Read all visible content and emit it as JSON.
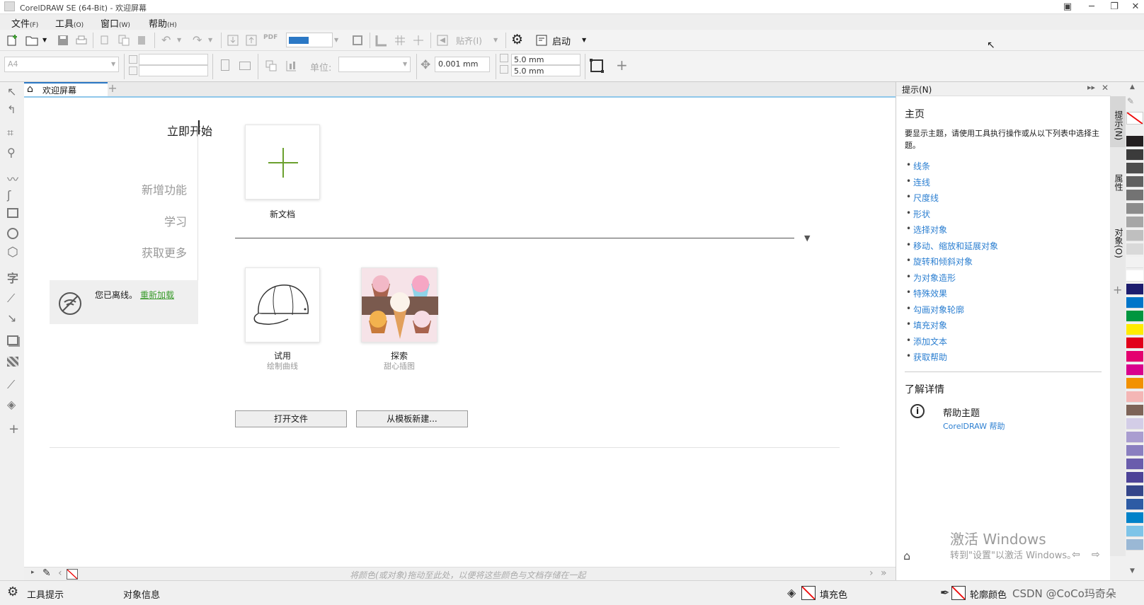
{
  "window": {
    "title": "CorelDRAW SE (64-Bit) - 欢迎屏幕"
  },
  "menu": [
    {
      "label": "文件",
      "key": "(F)"
    },
    {
      "label": "工具",
      "key": "(O)"
    },
    {
      "label": "窗口",
      "key": "(W)"
    },
    {
      "label": "帮助",
      "key": "(H)"
    }
  ],
  "toolbar": {
    "snap_label": "贴齐(I)",
    "launch_label": "启动",
    "pdf_label": "PDF"
  },
  "propbar": {
    "page_size": "A4",
    "unit_label": "单位:",
    "nudge": "0.001 mm",
    "dup_x": "5.0 mm",
    "dup_y": "5.0 mm"
  },
  "tab": {
    "label": "欢迎屏幕",
    "add": "+"
  },
  "welcome": {
    "nav": [
      {
        "label": "立即开始",
        "active": true
      },
      {
        "label": "新增功能"
      },
      {
        "label": "学习"
      },
      {
        "label": "获取更多"
      }
    ],
    "offline_text": "您已离线。",
    "reload_link": "重新加载",
    "new_doc": "新文档",
    "cards": [
      {
        "title": "试用",
        "subtitle": "绘制曲线"
      },
      {
        "title": "探索",
        "subtitle": "甜心插图"
      }
    ],
    "open_file": "打开文件",
    "from_template": "从模板新建..."
  },
  "hints": {
    "panel_title": "提示(N)",
    "heading": "主页",
    "intro": "要显示主题，请使用工具执行操作或从以下列表中选择主题。",
    "topics": [
      "线条",
      "连线",
      "尺度线",
      "形状",
      "选择对象",
      "移动、缩放和延展对象",
      "旋转和倾斜对象",
      "为对象造形",
      "特殊效果",
      "勾画对象轮廓",
      "填充对象",
      "添加文本",
      "获取帮助"
    ],
    "learn_more": "了解详情",
    "help_topic": "帮助主题",
    "help_link": "CorelDRAW 帮助"
  },
  "sidetabs": [
    "提示(N)",
    "属性",
    "对象(O)"
  ],
  "colorbar": {
    "hint": "将颜色(或对象)拖动至此处，以便将这些颜色与文档存储在一起"
  },
  "status": {
    "tool_tips": "工具提示",
    "object_info": "对象信息",
    "fill": "填充色",
    "outline": "轮廓颜色"
  },
  "watermark": {
    "activate": "激活 Windows",
    "goto": "转到\"设置\"以激活 Windows。",
    "csdn": "CSDN @CoCo玛奇朵"
  },
  "palette_colors": [
    "#231f20",
    "#3b3b3b",
    "#4d4d4d",
    "#606060",
    "#737373",
    "#8c8c8c",
    "#a6a6a6",
    "#bfbfbf",
    "#d9d9d9",
    "#f2f2f2",
    "#ffffff",
    "#1c1c6e",
    "#0075c9",
    "#00963f",
    "#ffeb00",
    "#e2001a",
    "#e4006f",
    "#d9008d",
    "#f29100",
    "#f4b6b5",
    "#7d6458",
    "#d3cde7",
    "#a99dd0",
    "#8a7fc0",
    "#6a5dac",
    "#4d4397",
    "#35468a",
    "#2d5ba4",
    "#0082c9",
    "#7ec4e8",
    "#9ab8d5"
  ]
}
